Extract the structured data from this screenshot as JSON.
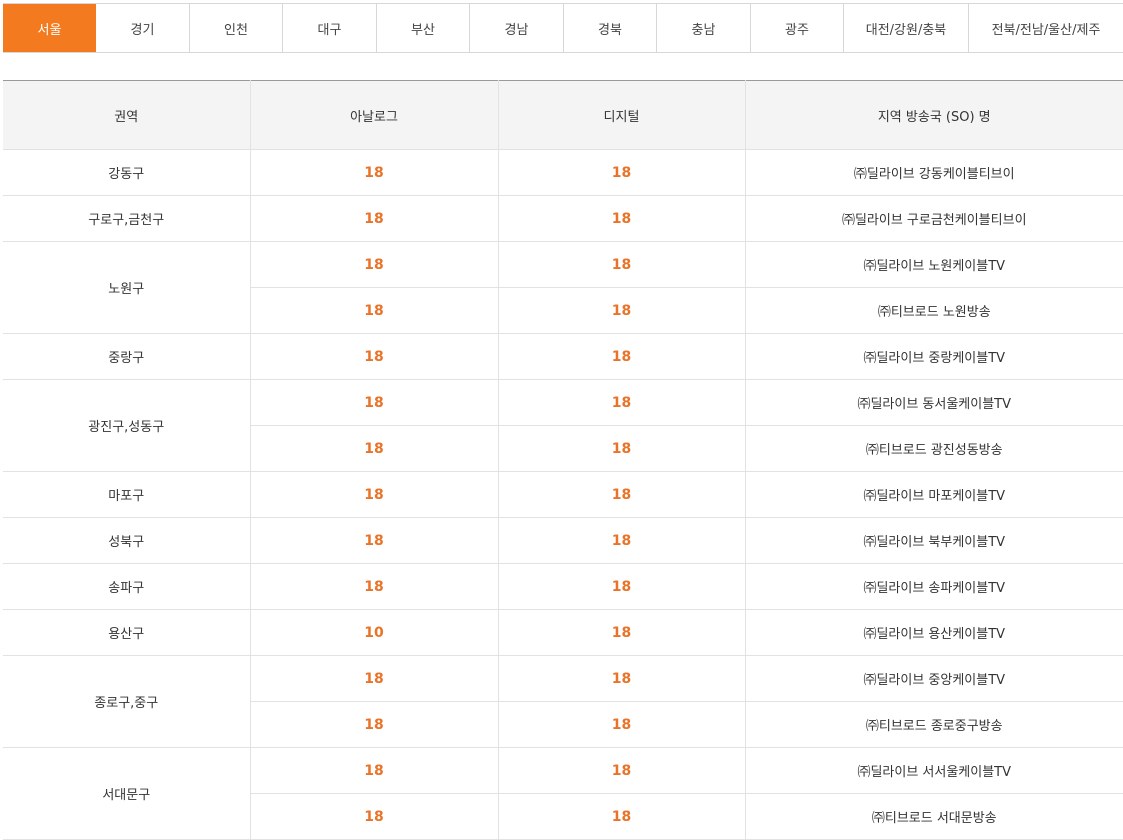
{
  "tabs": [
    {
      "label": "서울",
      "active": true
    },
    {
      "label": "경기"
    },
    {
      "label": "인천"
    },
    {
      "label": "대구"
    },
    {
      "label": "부산"
    },
    {
      "label": "경남"
    },
    {
      "label": "경북"
    },
    {
      "label": "충남"
    },
    {
      "label": "광주"
    },
    {
      "label": "대전/강원/충북"
    },
    {
      "label": "전북/전남/울산/제주"
    }
  ],
  "accent_color": "#f47a20",
  "number_color": "#e8742a",
  "table": {
    "headers": [
      "권역",
      "아날로그",
      "디지털",
      "지역 방송국 (SO) 명"
    ],
    "groups": [
      {
        "region": "강동구",
        "rows": [
          {
            "analog": "18",
            "digital": "18",
            "so": "㈜딜라이브 강동케이블티브이"
          }
        ]
      },
      {
        "region": "구로구,금천구",
        "rows": [
          {
            "analog": "18",
            "digital": "18",
            "so": "㈜딜라이브 구로금천케이블티브이"
          }
        ]
      },
      {
        "region": "노원구",
        "rows": [
          {
            "analog": "18",
            "digital": "18",
            "so": "㈜딜라이브 노원케이블TV"
          },
          {
            "analog": "18",
            "digital": "18",
            "so": "㈜티브로드 노원방송"
          }
        ]
      },
      {
        "region": "중랑구",
        "rows": [
          {
            "analog": "18",
            "digital": "18",
            "so": "㈜딜라이브 중랑케이블TV"
          }
        ]
      },
      {
        "region": "광진구,성동구",
        "rows": [
          {
            "analog": "18",
            "digital": "18",
            "so": "㈜딜라이브 동서울케이블TV"
          },
          {
            "analog": "18",
            "digital": "18",
            "so": "㈜티브로드 광진성동방송"
          }
        ]
      },
      {
        "region": "마포구",
        "rows": [
          {
            "analog": "18",
            "digital": "18",
            "so": "㈜딜라이브 마포케이블TV"
          }
        ]
      },
      {
        "region": "성북구",
        "rows": [
          {
            "analog": "18",
            "digital": "18",
            "so": "㈜딜라이브 북부케이블TV"
          }
        ]
      },
      {
        "region": "송파구",
        "rows": [
          {
            "analog": "18",
            "digital": "18",
            "so": "㈜딜라이브 송파케이블TV"
          }
        ]
      },
      {
        "region": "용산구",
        "rows": [
          {
            "analog": "10",
            "digital": "18",
            "so": "㈜딜라이브 용산케이블TV"
          }
        ]
      },
      {
        "region": "종로구,중구",
        "rows": [
          {
            "analog": "18",
            "digital": "18",
            "so": "㈜딜라이브 중앙케이블TV"
          },
          {
            "analog": "18",
            "digital": "18",
            "so": "㈜티브로드 종로중구방송"
          }
        ]
      },
      {
        "region": "서대문구",
        "rows": [
          {
            "analog": "18",
            "digital": "18",
            "so": "㈜딜라이브 서서울케이블TV"
          },
          {
            "analog": "18",
            "digital": "18",
            "so": "㈜티브로드 서대문방송"
          }
        ]
      }
    ]
  }
}
